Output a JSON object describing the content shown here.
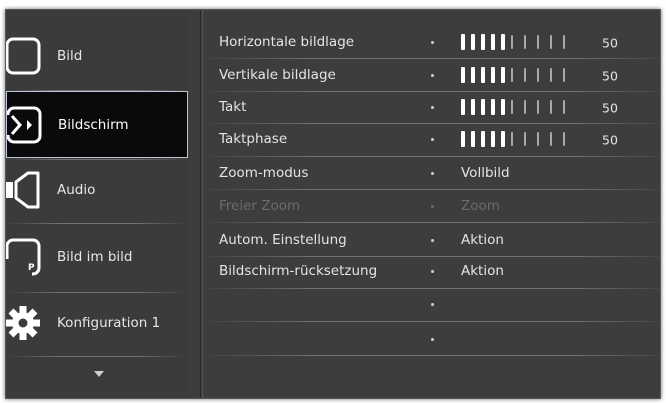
{
  "categories": [
    {
      "label": "Bild",
      "icon": "picture-icon",
      "selected": false
    },
    {
      "label": "Bildschirm",
      "icon": "screen-icon",
      "selected": true
    },
    {
      "label": "Audio",
      "icon": "speaker-icon",
      "selected": false
    },
    {
      "label": "Bild im bild",
      "icon": "pip-icon",
      "selected": false,
      "icon_text": "P"
    },
    {
      "label": "Konfiguration 1",
      "icon": "gear-icon",
      "selected": false
    }
  ],
  "more_indicator": "chevron-down-icon",
  "settings": [
    {
      "name": "Horizontale bildlage",
      "type": "slider",
      "value": 50,
      "level": 0.5
    },
    {
      "name": "Vertikale bildlage",
      "type": "slider",
      "value": 50,
      "level": 0.5
    },
    {
      "name": "Takt",
      "type": "slider",
      "value": 50,
      "level": 0.5
    },
    {
      "name": "Taktphase",
      "type": "slider",
      "value": 50,
      "level": 0.5
    },
    {
      "name": "Zoom-modus",
      "type": "option",
      "value": "Vollbild"
    },
    {
      "name": "Freier Zoom",
      "type": "option",
      "value": "Zoom",
      "disabled": true
    },
    {
      "name": "Autom. Einstellung",
      "type": "option",
      "value": "Aktion"
    },
    {
      "name": "Bildschirm-rücksetzung",
      "type": "option",
      "value": "Aktion"
    },
    {
      "name": "",
      "type": "empty",
      "value": ""
    },
    {
      "name": "",
      "type": "empty",
      "value": ""
    }
  ],
  "colors": {
    "panel": "#3d3d3d",
    "selected_bg": "#0a0a0a",
    "selected_border": "#b9c7d7",
    "text": "#e4e4e4",
    "disabled": "#6b6b6b"
  }
}
